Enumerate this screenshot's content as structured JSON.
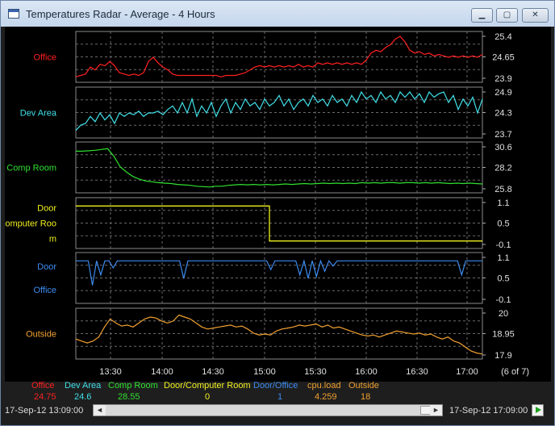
{
  "window": {
    "title": "Temperatures Radar - Average - 4 Hours",
    "controls": {
      "minimize": "▁",
      "maximize": "▢",
      "close": "✕"
    }
  },
  "page_indicator": "(6 of 7)",
  "time_axis": [
    "13:30",
    "14:00",
    "14:30",
    "15:00",
    "15:30",
    "16:00",
    "16:30",
    "17:00"
  ],
  "panels": [
    {
      "id": "office",
      "label_lines": [
        "Office"
      ],
      "color": "#ff2020",
      "ticks": [
        "25.4",
        "24.65",
        "23.9"
      ],
      "ymin": 23.9,
      "ymax": 25.4,
      "trace": [
        23.95,
        24.0,
        24.05,
        24.3,
        24.2,
        24.4,
        24.35,
        24.5,
        24.35,
        24.1,
        24.05,
        24.0,
        24.05,
        24.0,
        24.1,
        24.5,
        24.65,
        24.45,
        24.3,
        24.2,
        24.05,
        24.0,
        24.0,
        24.0,
        24.0,
        24.0,
        24.0,
        24.0,
        24.0,
        24.0,
        23.95,
        24.0,
        24.0,
        24.0,
        24.05,
        24.1,
        24.2,
        24.3,
        24.35,
        24.3,
        24.35,
        24.3,
        24.35,
        24.3,
        24.35,
        24.3,
        24.4,
        24.3,
        24.35,
        24.3,
        24.45,
        24.4,
        24.45,
        24.4,
        24.45,
        24.4,
        24.45,
        24.4,
        24.45,
        24.4,
        24.55,
        24.8,
        24.9,
        24.85,
        25.0,
        25.1,
        25.3,
        25.4,
        25.2,
        24.9,
        24.8,
        24.85,
        24.75,
        24.8,
        24.7,
        24.75,
        24.7,
        24.65,
        24.7,
        24.65,
        24.7,
        24.65,
        24.7,
        24.65,
        24.75
      ]
    },
    {
      "id": "dev-area",
      "label_lines": [
        "Dev Area"
      ],
      "color": "#40e0e8",
      "ticks": [
        "24.9",
        "24.3",
        "23.7"
      ],
      "ymin": 23.7,
      "ymax": 24.9,
      "trace": [
        23.8,
        23.95,
        24.0,
        24.2,
        24.05,
        24.3,
        24.1,
        24.25,
        24.0,
        24.3,
        24.2,
        24.3,
        24.25,
        24.35,
        24.2,
        24.3,
        24.3,
        24.35,
        24.25,
        24.4,
        24.5,
        24.3,
        24.6,
        24.3,
        24.7,
        24.2,
        24.5,
        24.3,
        24.6,
        24.2,
        24.5,
        24.7,
        24.3,
        24.6,
        24.4,
        24.7,
        24.5,
        24.6,
        24.4,
        24.7,
        24.5,
        24.6,
        24.8,
        24.5,
        24.7,
        24.4,
        24.6,
        24.7,
        24.5,
        24.8,
        24.6,
        24.7,
        24.5,
        24.8,
        24.6,
        24.7,
        24.5,
        24.8,
        24.6,
        24.9,
        24.7,
        24.8,
        24.6,
        24.9,
        24.7,
        24.8,
        24.6,
        24.9,
        24.75,
        24.9,
        24.7,
        24.85,
        24.6,
        24.9,
        24.75,
        24.85,
        24.9,
        24.6,
        24.8,
        24.4,
        24.7,
        24.5,
        24.75,
        24.3,
        24.7
      ]
    },
    {
      "id": "comp-room",
      "label_lines": [
        "Comp Room"
      ],
      "color": "#30e030",
      "ticks": [
        "30.6",
        "28.2",
        "25.8"
      ],
      "ymin": 25.8,
      "ymax": 30.6,
      "trace": [
        30.1,
        30.1,
        30.15,
        30.2,
        30.3,
        30.4,
        29.5,
        28.3,
        27.7,
        27.2,
        26.9,
        26.7,
        26.6,
        26.5,
        26.45,
        26.4,
        26.3,
        26.25,
        26.2,
        26.1,
        26.05,
        26.0,
        26.1,
        26.1,
        26.2,
        26.25,
        26.3,
        26.25,
        26.3,
        26.25,
        26.3,
        26.25,
        26.3,
        26.35,
        26.3,
        26.35,
        26.4,
        26.35,
        26.4,
        26.45,
        26.4,
        26.45,
        26.4,
        26.45,
        26.4,
        26.5,
        26.45,
        26.5,
        26.45,
        26.5,
        26.5,
        26.45,
        26.5,
        26.5,
        26.45,
        26.5,
        26.45,
        26.5,
        26.45,
        26.4,
        26.45,
        26.4,
        26.45,
        26.4,
        26.35
      ]
    },
    {
      "id": "door-computer-room",
      "label_lines": [
        "Door",
        "Computer Roo",
        "m"
      ],
      "color": "#f0f020",
      "ticks": [
        "1.1",
        "0.5",
        "-0.1"
      ],
      "ymin": -0.1,
      "ymax": 1.1,
      "trace": [
        1,
        1,
        1,
        1,
        1,
        1,
        1,
        1,
        1,
        1,
        1,
        1,
        1,
        1,
        1,
        1,
        1,
        1,
        1,
        1,
        1,
        1,
        1,
        1,
        1,
        1,
        1,
        1,
        1,
        1,
        1,
        1,
        1,
        1,
        1,
        1,
        1,
        1,
        1,
        1,
        0,
        0,
        0,
        0,
        0,
        0,
        0,
        0,
        0,
        0,
        0,
        0,
        0,
        0,
        0,
        0,
        0,
        0,
        0,
        0,
        0,
        0,
        0,
        0,
        0,
        0,
        0,
        0,
        0,
        0,
        0,
        0,
        0,
        0,
        0,
        0,
        0,
        0,
        0,
        0,
        0,
        0,
        0,
        0,
        0
      ]
    },
    {
      "id": "door-office",
      "label_lines": [
        "Door",
        "Office"
      ],
      "color": "#3c8cf0",
      "ticks": [
        "1.1",
        "0.5",
        "-0.1"
      ],
      "ymin": -0.1,
      "ymax": 1.1,
      "trace": [
        1,
        1,
        1,
        1,
        0.3,
        1,
        0.6,
        1,
        1,
        0.8,
        1,
        1,
        1,
        1,
        1,
        1,
        1,
        1,
        1,
        1,
        1,
        1,
        1,
        1,
        1,
        1,
        0.5,
        1,
        1,
        1,
        1,
        1,
        1,
        1,
        1,
        1,
        1,
        1,
        1,
        1,
        1,
        1,
        1,
        1,
        1,
        1,
        1,
        0.75,
        1,
        1,
        1,
        1,
        1,
        1,
        0.6,
        1,
        0.5,
        1,
        0.55,
        1,
        0.7,
        1,
        0.85,
        1,
        1,
        1,
        1,
        1,
        1,
        1,
        1,
        1,
        1,
        1,
        1,
        1,
        1,
        1,
        1,
        1,
        1,
        1,
        1,
        1,
        1,
        1,
        1,
        1,
        1,
        1,
        1,
        1,
        1,
        0.6,
        1,
        1,
        1,
        1,
        1
      ]
    },
    {
      "id": "outside",
      "label_lines": [
        "Outside"
      ],
      "color": "#f0a030",
      "ticks": [
        "20",
        "18.95",
        "17.9"
      ],
      "ymin": 17.9,
      "ymax": 20.0,
      "trace": [
        18.7,
        18.6,
        18.5,
        18.6,
        18.8,
        19.3,
        19.7,
        19.5,
        19.35,
        19.4,
        19.3,
        19.5,
        19.7,
        19.8,
        19.75,
        19.6,
        19.5,
        19.6,
        19.9,
        19.8,
        19.7,
        19.5,
        19.3,
        19.2,
        19.25,
        19.3,
        19.35,
        19.4,
        19.3,
        19.35,
        19.2,
        19.0,
        18.9,
        18.95,
        18.9,
        19.1,
        19.2,
        19.25,
        19.3,
        19.4,
        19.35,
        19.4,
        19.45,
        19.3,
        19.4,
        19.25,
        19.3,
        19.2,
        19.1,
        19.0,
        18.9,
        18.85,
        18.9,
        18.8,
        18.9,
        19.0,
        19.1,
        19.05,
        19.0,
        18.95,
        19.0,
        18.9,
        18.95,
        18.8,
        18.7,
        18.8,
        18.6,
        18.5,
        18.3,
        18.1,
        18.0,
        17.95
      ]
    }
  ],
  "legend": [
    {
      "name": "Office",
      "value": "24.75",
      "color": "#ff2020"
    },
    {
      "name": "Dev Area",
      "value": "24.6",
      "color": "#40e0e8"
    },
    {
      "name": "Comp Room",
      "value": "28.55",
      "color": "#30e030"
    },
    {
      "name": "Door/Computer Room",
      "value": "0",
      "color": "#f0f020"
    },
    {
      "name": "Door/Office",
      "value": "1",
      "color": "#3c8cf0"
    },
    {
      "name": "cpu.load",
      "value": "4.259",
      "color": "#f0a030"
    },
    {
      "name": "Outside",
      "value": "18",
      "color": "#f0a030"
    }
  ],
  "range": {
    "start": "17-Sep-12 13:09:00",
    "end": "17-Sep-12 17:09:00"
  },
  "scroll": {
    "left_arrow": "◄",
    "right_arrow": "►"
  }
}
